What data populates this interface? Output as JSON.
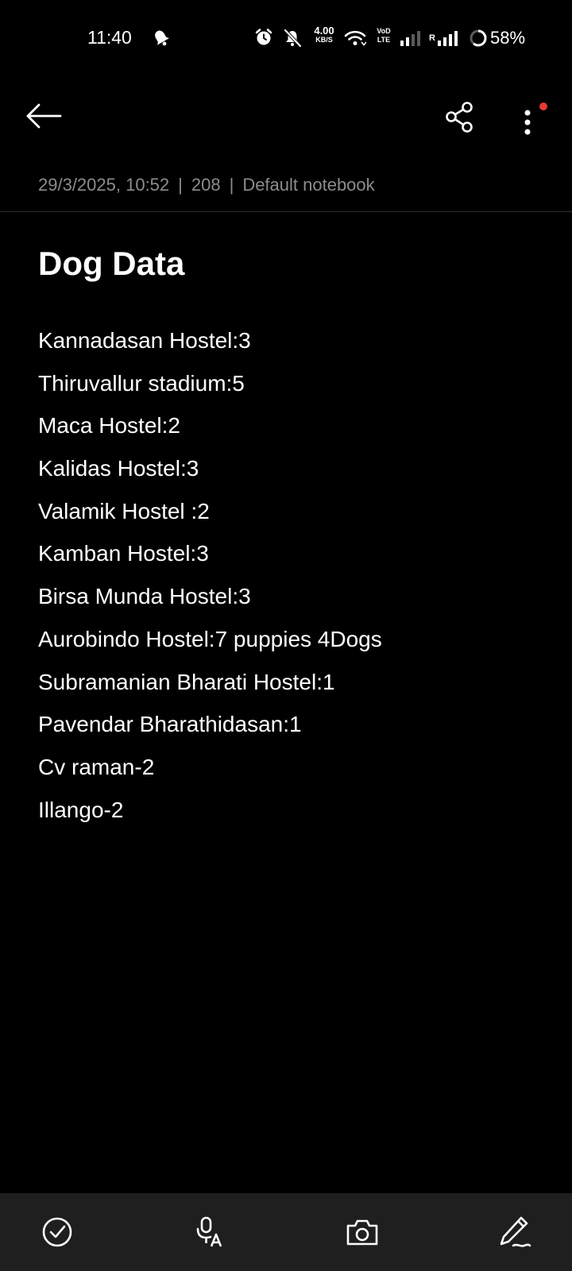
{
  "status_bar": {
    "time": "11:40",
    "net_speed_value": "4.00",
    "net_speed_unit": "KB/S",
    "volte_line1": "VoD",
    "volte_line2": "LTE",
    "roaming": "R",
    "battery_percent": "58%",
    "icons": [
      "notification-bell-icon",
      "alarm-icon",
      "mute-icon",
      "wifi-icon",
      "signal-icon",
      "signal-roaming-icon",
      "battery-ring-icon"
    ]
  },
  "toolbar": {
    "icons": [
      "back-arrow-icon",
      "share-icon",
      "more-vertical-icon"
    ],
    "notification_dot_color": "#e53935"
  },
  "note_meta": {
    "date": "29/3/2025, 10:52",
    "separator": "|",
    "char_count": "208",
    "notebook": "Default notebook"
  },
  "note": {
    "title": "Dog Data",
    "lines": [
      "Kannadasan Hostel:3",
      "Thiruvallur stadium:5",
      "Maca Hostel:2",
      "Kalidas Hostel:3",
      "Valamik Hostel :2",
      "Kamban Hostel:3",
      "Birsa Munda Hostel:3",
      "Aurobindo Hostel:7 puppies 4Dogs",
      "Subramanian Bharati Hostel:1",
      "Pavendar Bharathidasan:1",
      "Cv raman-2",
      "Illango-2"
    ]
  },
  "bottom_bar": {
    "icons": [
      "checkbox-check-icon",
      "voice-to-text-icon",
      "camera-icon",
      "pen-draw-icon"
    ],
    "background": "#1f1f1f"
  }
}
